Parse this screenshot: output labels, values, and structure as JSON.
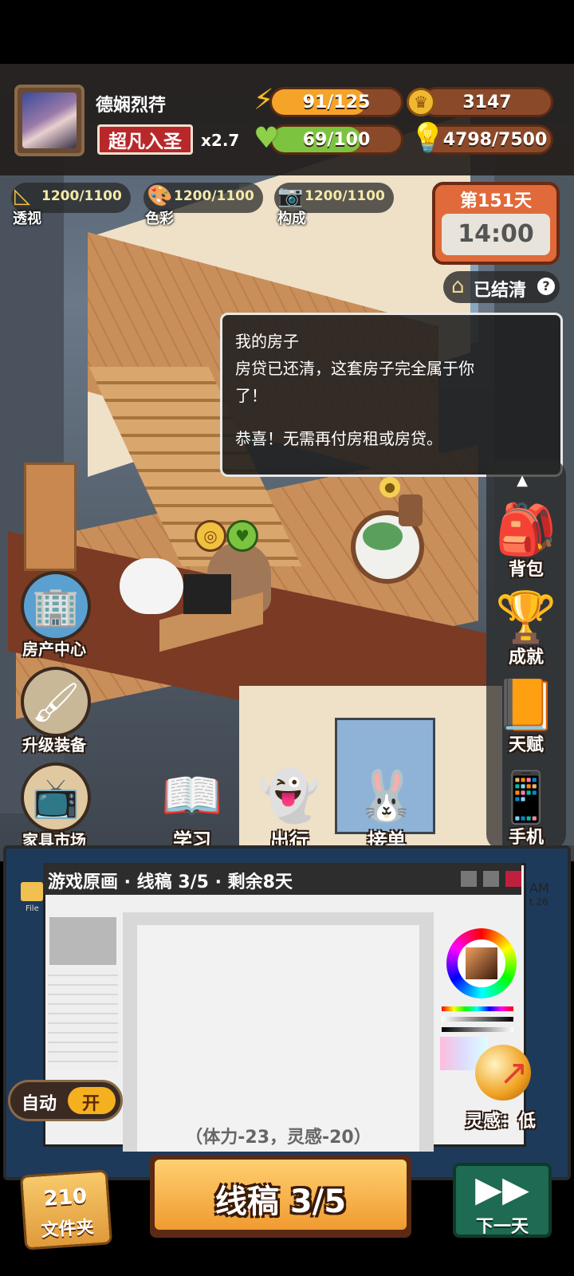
{
  "player": {
    "name": "德娴烈荇",
    "title": "超凡入圣",
    "multiplier": "x2.7"
  },
  "stats": {
    "energy": {
      "value": "91/125",
      "fraction": 0.73,
      "icon": "lightning-icon"
    },
    "health": {
      "value": "69/100",
      "fraction": 0.69,
      "icon": "heart-icon"
    },
    "coins": {
      "value": "3147",
      "icon": "coin-icon"
    },
    "inspiration": {
      "value": "4798/7500",
      "icon": "lightbulb-icon"
    }
  },
  "skills": [
    {
      "label": "透视",
      "value": "1200/1100",
      "icon": "ruler-icon"
    },
    {
      "label": "色彩",
      "value": "1200/1100",
      "icon": "palette-icon"
    },
    {
      "label": "构成",
      "value": "1200/1100",
      "icon": "camera-icon"
    }
  ],
  "calendar": {
    "day": "第151天",
    "time": "14:00"
  },
  "house_status": "已结清",
  "help_icon": "?",
  "dialog": {
    "title": "我的房子",
    "line1": "房贷已还清，这套房子完全属于你",
    "line2": "了！",
    "line3": "恭喜！无需再付房租或房贷。"
  },
  "right_menu": [
    {
      "label": "背包",
      "icon": "backpack-icon"
    },
    {
      "label": "成就",
      "icon": "trophy-icon"
    },
    {
      "label": "天赋",
      "icon": "book-icon"
    },
    {
      "label": "手机",
      "icon": "phone-icon"
    }
  ],
  "left_menu": [
    {
      "label": "房产中心",
      "icon": "building-icon"
    },
    {
      "label": "升级装备",
      "icon": "brush-icon"
    },
    {
      "label": "家具市场",
      "icon": "tv-icon"
    }
  ],
  "bottom_actions": [
    {
      "label": "学习",
      "icon": "book-pen-icon"
    },
    {
      "label": "出行",
      "icon": "ghost-icon"
    },
    {
      "label": "接单",
      "icon": "bunny-icon"
    }
  ],
  "task": {
    "title": "游戏原画 · 线稿 3/5 · 剩余8天",
    "cost": "（体力-23，灵感-20）",
    "inspiration_label": "灵感：低",
    "corner_text_1": "AM",
    "corner_text_2": "t 26",
    "file_label": "File"
  },
  "auto": {
    "label": "自动",
    "state": "开"
  },
  "folder": {
    "count": "210",
    "label": "文件夹"
  },
  "main_button": "线稿 3/5",
  "next_day": "下一天",
  "colors": {
    "accent": "#f0a040",
    "health": "#7cc440",
    "energy": "#f5a42a",
    "next": "#2e8a6a"
  }
}
